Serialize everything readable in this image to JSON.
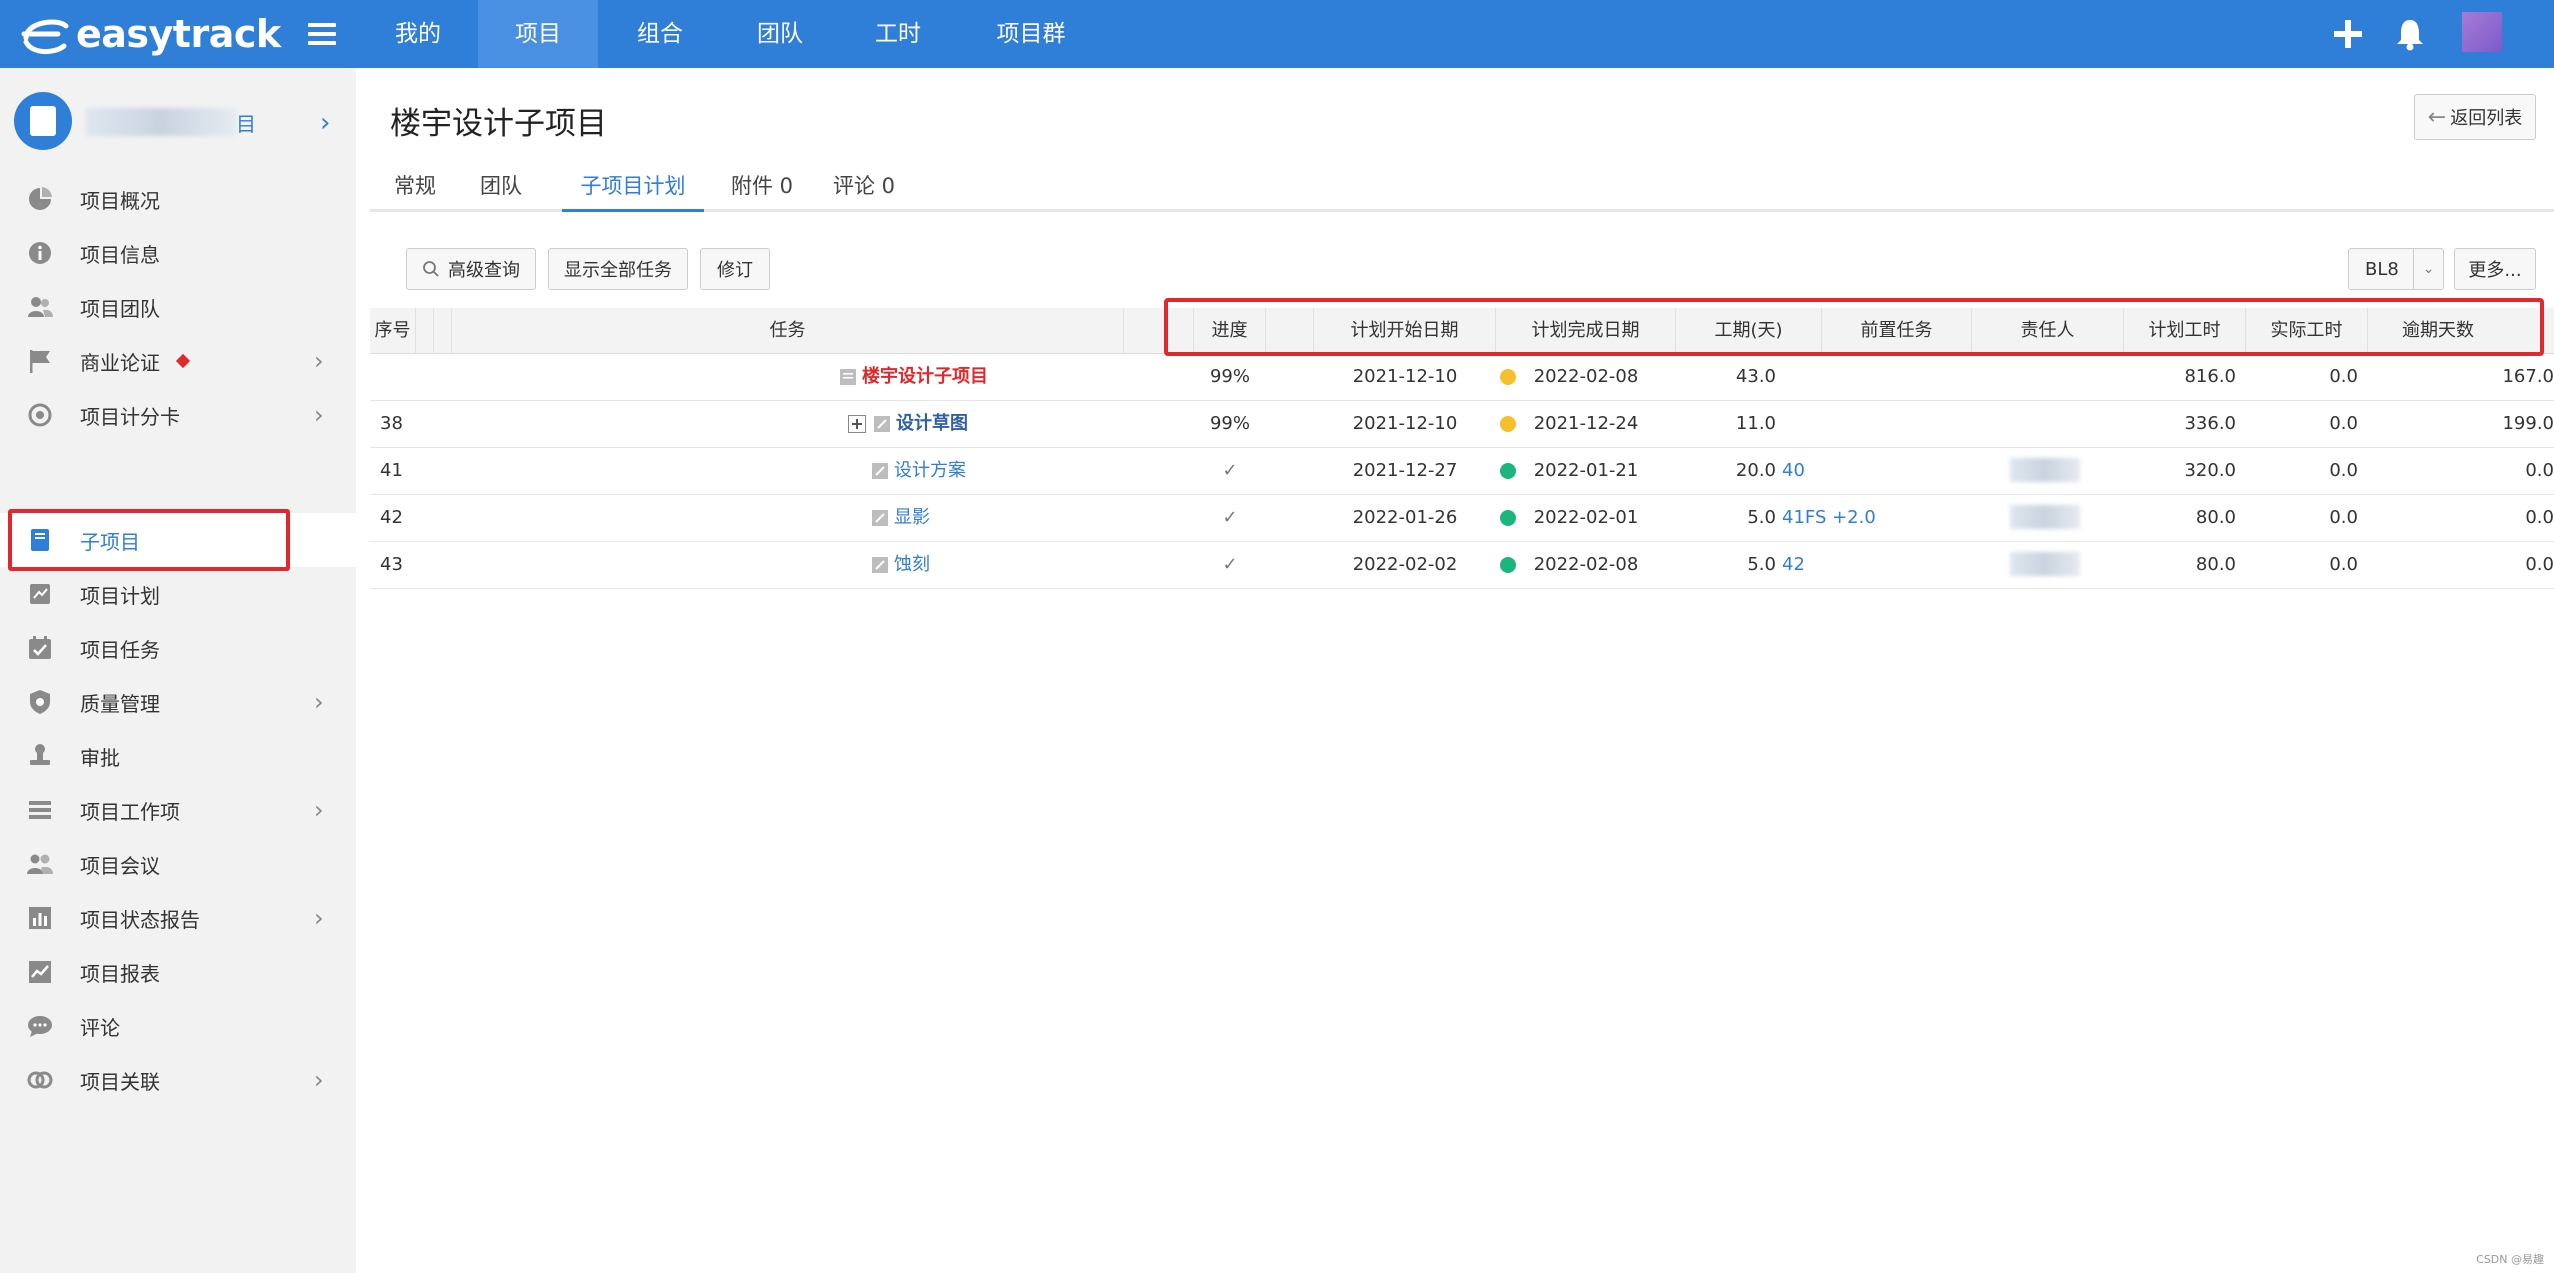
{
  "brand": {
    "logo_text": "easytrack"
  },
  "topnav": {
    "items": [
      {
        "label": "我的"
      },
      {
        "label": "项目"
      },
      {
        "label": "组合"
      },
      {
        "label": "团队"
      },
      {
        "label": "工时"
      },
      {
        "label": "项目群"
      }
    ],
    "active_index": 1
  },
  "sidebar": {
    "project_name_suffix": "目",
    "items": [
      {
        "label": "项目概况",
        "icon": "pie-chart-icon"
      },
      {
        "label": "项目信息",
        "icon": "info-icon"
      },
      {
        "label": "项目团队",
        "icon": "people-icon"
      },
      {
        "label": "商业论证",
        "icon": "flag-icon",
        "has_submenu": true,
        "badge": "red-diamond"
      },
      {
        "label": "项目计分卡",
        "icon": "target-icon",
        "has_submenu": true
      },
      {
        "label": "子项目",
        "icon": "book-icon",
        "active": true
      },
      {
        "label": "项目计划",
        "icon": "plan-icon"
      },
      {
        "label": "项目任务",
        "icon": "calendar-check-icon"
      },
      {
        "label": "质量管理",
        "icon": "shield-icon",
        "has_submenu": true
      },
      {
        "label": "审批",
        "icon": "stamp-icon"
      },
      {
        "label": "项目工作项",
        "icon": "stack-icon",
        "has_submenu": true
      },
      {
        "label": "项目会议",
        "icon": "meeting-icon"
      },
      {
        "label": "项目状态报告",
        "icon": "bar-chart-icon",
        "has_submenu": true
      },
      {
        "label": "项目报表",
        "icon": "line-chart-icon"
      },
      {
        "label": "评论",
        "icon": "comment-icon"
      },
      {
        "label": "项目关联",
        "icon": "link-icon",
        "has_submenu": true
      }
    ]
  },
  "page": {
    "title": "楼宇设计子项目",
    "back_label": "返回列表"
  },
  "tabs": [
    {
      "label": "常规"
    },
    {
      "label": "团队"
    },
    {
      "label": "子项目计划",
      "active": true
    },
    {
      "label": "附件 0"
    },
    {
      "label": "评论 0"
    }
  ],
  "toolbar": {
    "advanced_query": "高级查询",
    "show_all": "显示全部任务",
    "revise": "修订",
    "baseline": "BL8",
    "more": "更多..."
  },
  "table": {
    "headers": {
      "seq": "序号",
      "task": "任务",
      "progress": "进度",
      "plan_start": "计划开始日期",
      "plan_end": "计划完成日期",
      "duration": "工期(天)",
      "predecessor": "前置任务",
      "owner": "责任人",
      "plan_hours": "计划工时",
      "actual_hours": "实际工时",
      "overdue_days": "逾期天数"
    },
    "rows": [
      {
        "seq": "",
        "task": "楼宇设计子项目",
        "status_color": "#f5c02c",
        "progress": "99%",
        "start": "2021-12-10",
        "end": "2022-02-08",
        "duration": "43.0",
        "predecessor": "",
        "plan_hours": "816.0",
        "actual_hours": "0.0",
        "overdue": "167.0"
      },
      {
        "seq": "38",
        "task": "设计草图",
        "status_color": "#f5c02c",
        "progress": "99%",
        "start": "2021-12-10",
        "end": "2021-12-24",
        "duration": "11.0",
        "predecessor": "",
        "plan_hours": "336.0",
        "actual_hours": "0.0",
        "overdue": "199.0"
      },
      {
        "seq": "41",
        "task": "设计方案",
        "status_color": "#1cb67c",
        "progress": "✓",
        "start": "2021-12-27",
        "end": "2022-01-21",
        "duration": "20.0",
        "predecessor": "40",
        "plan_hours": "320.0",
        "actual_hours": "0.0",
        "overdue": "0.0"
      },
      {
        "seq": "42",
        "task": "显影",
        "status_color": "#1cb67c",
        "progress": "✓",
        "start": "2022-01-26",
        "end": "2022-02-01",
        "duration": "5.0",
        "predecessor": "41FS +2.0",
        "plan_hours": "80.0",
        "actual_hours": "0.0",
        "overdue": "0.0"
      },
      {
        "seq": "43",
        "task": "蚀刻",
        "status_color": "#1cb67c",
        "progress": "✓",
        "start": "2022-02-02",
        "end": "2022-02-08",
        "duration": "5.0",
        "predecessor": "42",
        "plan_hours": "80.0",
        "actual_hours": "0.0",
        "overdue": "0.0"
      }
    ]
  },
  "watermark": "CSDN @易趣",
  "colors": {
    "accent": "#2f7ed8",
    "highlight": "#e0282d",
    "root_task": "#e0282d"
  }
}
